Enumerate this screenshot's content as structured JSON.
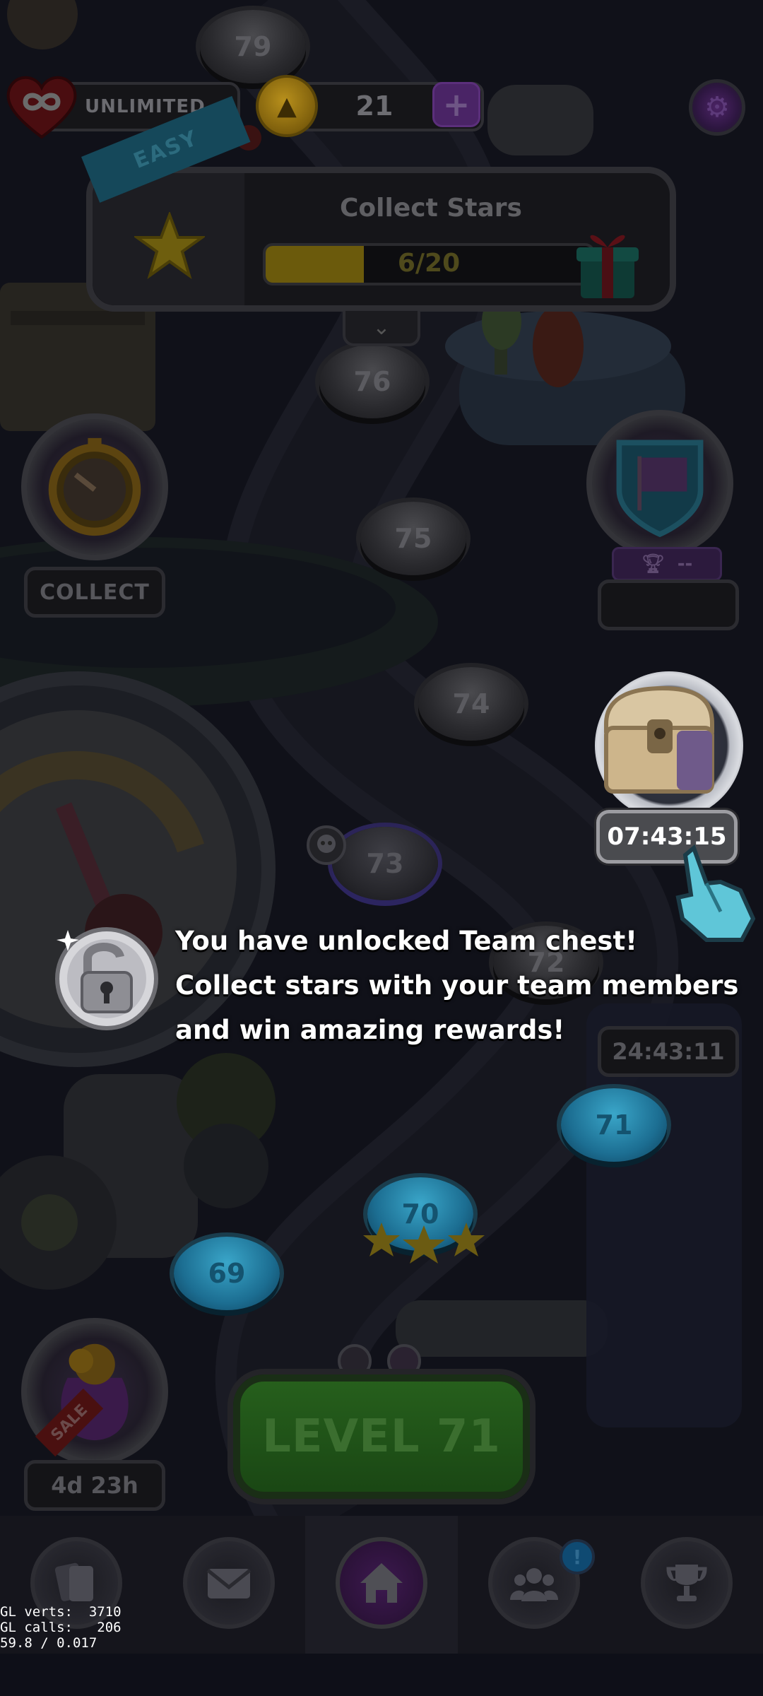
{
  "hud": {
    "lives_label": "UNLIMITED",
    "coins": "21",
    "add_label": "+"
  },
  "event": {
    "difficulty": "EASY",
    "title": "Collect Stars",
    "progress_text": "6/20",
    "progress_fraction": 0.3
  },
  "left_widgets": {
    "collect_label": "COLLECT",
    "sale_badge": "SALE",
    "sale_timer": "4d 23h"
  },
  "right_widgets": {
    "flag_bar_value": "--",
    "chest_timer": "07:43:15",
    "second_timer": "24:43:11"
  },
  "map": {
    "levels": [
      "79",
      "76",
      "75",
      "74",
      "73",
      "72",
      "71",
      "70",
      "69"
    ],
    "level_70_stars": 3
  },
  "tutorial": {
    "lines": [
      "You have unlocked Team chest!",
      "Collect stars with your team members",
      "and win amazing rewards!"
    ]
  },
  "play_button": {
    "label": "LEVEL 71"
  },
  "nav": {
    "items": [
      "cards",
      "mail",
      "home",
      "team",
      "trophy"
    ],
    "active": "home",
    "team_badge": "!"
  },
  "debug": {
    "line1": "GL verts:  3710",
    "line2": "GL calls:   206",
    "line3": "59.8 / 0.017"
  },
  "colors": {
    "background": "#0b0c14",
    "progress_fill": "#6b5a0c",
    "play_green": "#265f1c",
    "nav_bg": "#15151c"
  }
}
